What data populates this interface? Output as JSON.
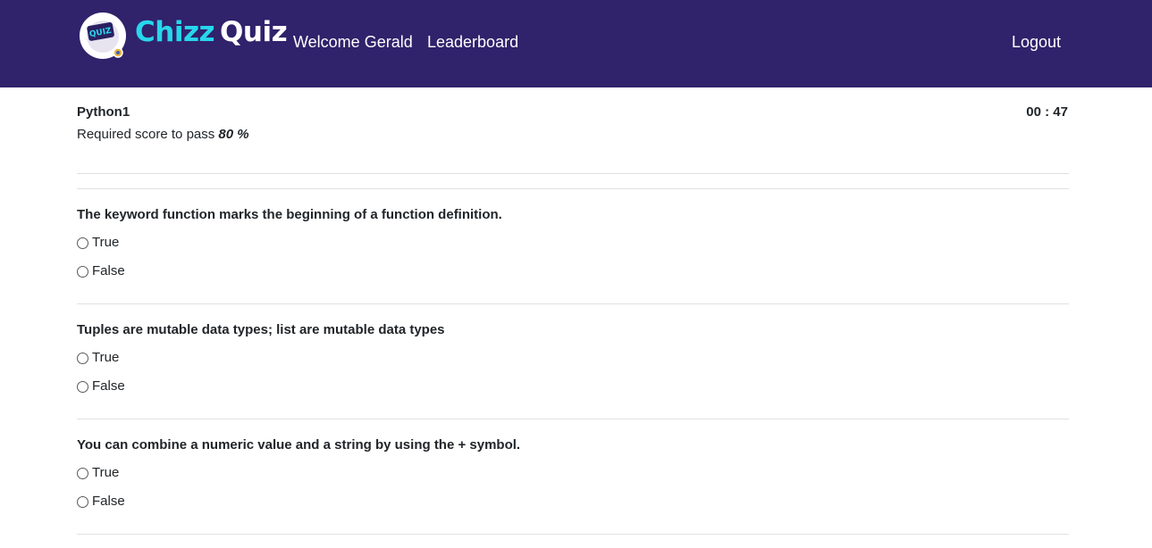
{
  "header": {
    "brand_part1": "Chizz",
    "brand_part2": "Quiz",
    "logo_text": "QUIZ",
    "welcome": "Welcome Gerald",
    "leaderboard": "Leaderboard",
    "logout": "Logout",
    "colors": {
      "navbar": "#30226b",
      "brand_accent": "#27d7ec"
    }
  },
  "quiz": {
    "name": "Python1",
    "timer": "00 : 47",
    "pass_label": "Required score to pass",
    "pass_value": "80 %"
  },
  "questions": [
    {
      "text": "The keyword function marks the beginning of a function definition.",
      "options": [
        "True",
        "False"
      ]
    },
    {
      "text": "Tuples are mutable data types; list are mutable data types",
      "options": [
        "True",
        "False"
      ]
    },
    {
      "text": "You can combine a numeric value and a string by using the + symbol.",
      "options": [
        "True",
        "False"
      ]
    }
  ]
}
